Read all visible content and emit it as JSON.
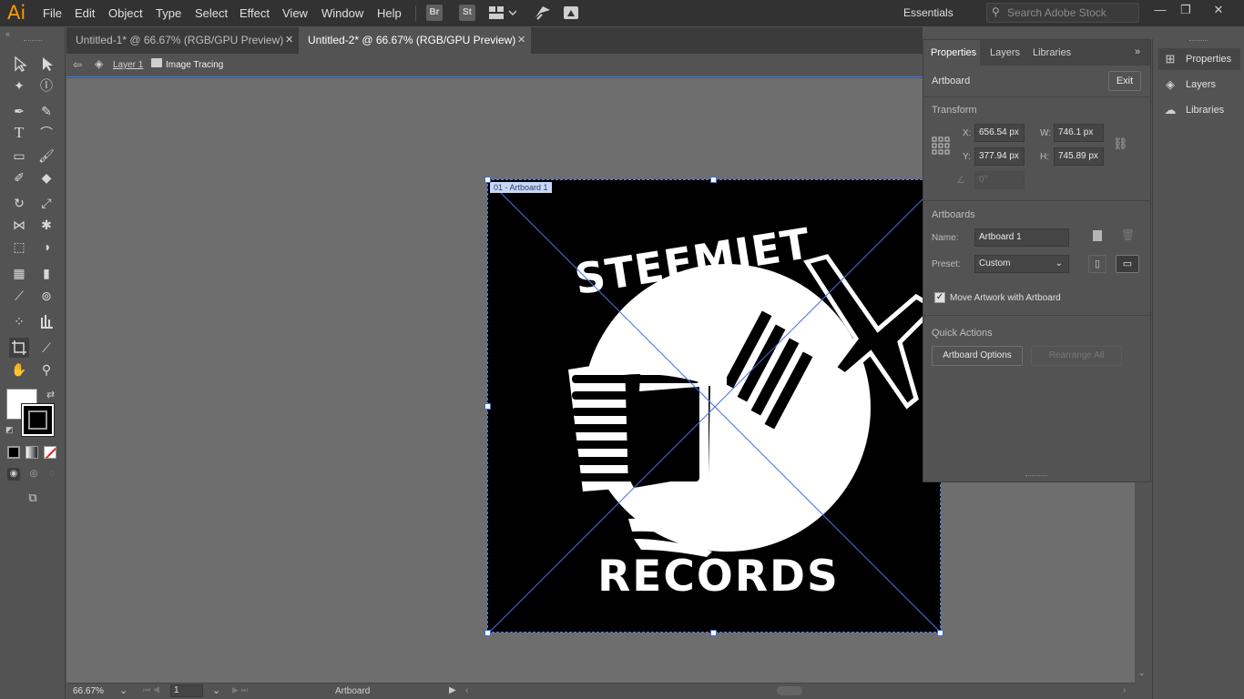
{
  "app": {
    "logo": "Ai",
    "menus": [
      "File",
      "Edit",
      "Object",
      "Type",
      "Select",
      "Effect",
      "View",
      "Window",
      "Help"
    ],
    "toolbar_icons": [
      "Br",
      "St"
    ],
    "workspace": "Essentials",
    "search_placeholder": "Search Adobe Stock"
  },
  "tabs": [
    {
      "label": "Untitled-1* @ 66.67% (RGB/GPU Preview)",
      "active": false
    },
    {
      "label": "Untitled-2* @ 66.67% (RGB/GPU Preview)",
      "active": true
    }
  ],
  "breadcrumb": {
    "layer": "Layer 1",
    "group": "Image Tracing"
  },
  "artboard": {
    "label": "01 - Artboard 1",
    "logo_top_text": "STEEMJET",
    "logo_bottom_text": "RECORDS"
  },
  "status": {
    "zoom": "66.67%",
    "page": "1",
    "mode": "Artboard"
  },
  "properties_panel": {
    "tabs": [
      "Properties",
      "Layers",
      "Libraries"
    ],
    "context": "Artboard",
    "exit_label": "Exit",
    "transform_title": "Transform",
    "x_label": "X:",
    "x": "656.54 px",
    "y_label": "Y:",
    "y": "377.94 px",
    "w_label": "W:",
    "w": "746.1 px",
    "h_label": "H:",
    "h": "745.89 px",
    "angle": "0°",
    "artboards_title": "Artboards",
    "name_label": "Name:",
    "name": "Artboard 1",
    "preset_label": "Preset:",
    "preset": "Custom",
    "move_artwork_label": "Move Artwork with Artboard",
    "move_artwork_checked": true,
    "quick_actions_title": "Quick Actions",
    "artboard_options": "Artboard Options",
    "rearrange_all": "Rearrange All"
  },
  "dock": [
    {
      "label": "Properties",
      "icon": "properties-icon"
    },
    {
      "label": "Layers",
      "icon": "layers-icon"
    },
    {
      "label": "Libraries",
      "icon": "libraries-icon"
    }
  ]
}
